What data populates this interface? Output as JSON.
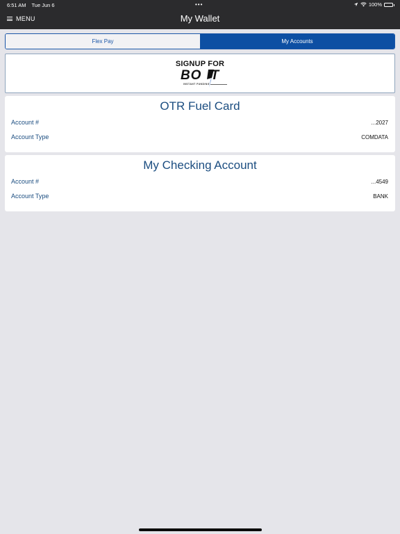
{
  "status_bar": {
    "time": "6:51 AM",
    "date": "Tue Jun 6",
    "dots": "•••",
    "battery_percent": "100%",
    "icons": [
      "location-arrow-icon",
      "wifi-icon",
      "battery-icon"
    ]
  },
  "nav": {
    "menu_label": "MENU",
    "title": "My Wallet"
  },
  "tabs": [
    {
      "label": "Flex Pay",
      "active": false
    },
    {
      "label": "My Accounts",
      "active": true
    }
  ],
  "banner": {
    "line1": "SIGNUP FOR",
    "logo_text": "BOLT",
    "logo_left": "BO",
    "logo_right": "T",
    "tagline": "INSTANT FUNDING"
  },
  "accounts": [
    {
      "name": "OTR Fuel Card",
      "account_number_label": "Account #",
      "account_number": "...2027",
      "account_type_label": "Account Type",
      "account_type": "COMDATA"
    },
    {
      "name": "My Checking Account",
      "account_number_label": "Account #",
      "account_number": "...4549",
      "account_type_label": "Account Type",
      "account_type": "BANK"
    }
  ],
  "colors": {
    "nav_background": "#2b2b2d",
    "accent_blue": "#0d4fa3",
    "label_blue": "#1b4d80",
    "page_background": "#e5e5ea"
  }
}
